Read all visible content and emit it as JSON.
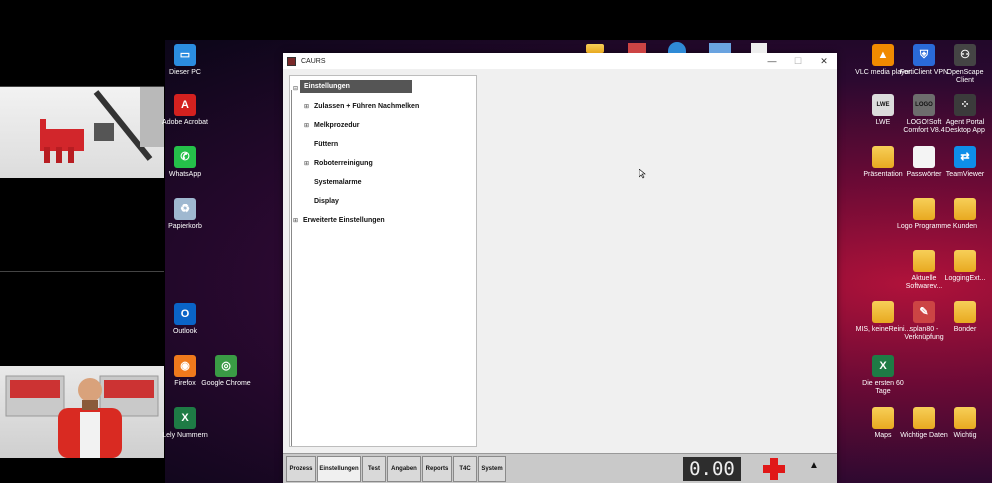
{
  "window": {
    "title": "CAURS",
    "minimize": "—",
    "maximize": "☐",
    "close": "✕"
  },
  "tree": {
    "items": [
      {
        "label": "Einstellungen",
        "expander": "⊟",
        "selected": true
      },
      {
        "label": "Zulassen + Führen Nachmelken",
        "expander": "⊞"
      },
      {
        "label": "Melkprozedur",
        "expander": "⊞"
      },
      {
        "label": "Füttern",
        "expander": ""
      },
      {
        "label": "Roboterreinigung",
        "expander": "⊞"
      },
      {
        "label": "Systemalarme",
        "expander": ""
      },
      {
        "label": "Display",
        "expander": ""
      },
      {
        "label": "Erweiterte Einstellungen",
        "expander": "⊞"
      }
    ]
  },
  "bottombar": {
    "tabs": [
      "Prozess",
      "Einstellungen",
      "Test",
      "Angaben",
      "Reports",
      "T4C",
      "System"
    ],
    "active_tab": "Einstellungen",
    "counter": "0.00",
    "arrow": "▲"
  },
  "desktop": {
    "left_icons": [
      {
        "label": "Dieser PC",
        "icon": "monitor-icon",
        "glyph": "▭",
        "color": "#2b8de0"
      },
      {
        "label": "Adobe Acrobat",
        "icon": "acrobat-icon",
        "glyph": "A",
        "color": "#d4211f"
      },
      {
        "label": "WhatsApp",
        "icon": "whatsapp-icon",
        "glyph": "✆",
        "color": "#25c04a"
      },
      {
        "label": "Papierkorb",
        "icon": "recycle-bin-icon",
        "glyph": "♻",
        "color": "#9fb8d0"
      },
      {
        "label": "Outlook",
        "icon": "outlook-icon",
        "glyph": "O",
        "color": "#0a64c7"
      },
      {
        "label": "Firefox",
        "icon": "firefox-icon",
        "glyph": "◉",
        "color": "#ef7a1c"
      },
      {
        "label": "Google Chrome",
        "icon": "chrome-icon",
        "glyph": "◎",
        "color": "#3a9b45"
      },
      {
        "label": "Lely Nummern",
        "icon": "excel-icon",
        "glyph": "X",
        "color": "#1e7b45"
      }
    ],
    "right_icons": [
      {
        "label": "VLC media player",
        "icon": "vlc-icon",
        "glyph": "▲",
        "color": "#f08a00"
      },
      {
        "label": "FortiClient VPN",
        "icon": "forticlient-icon",
        "glyph": "⛨",
        "color": "#2a6ad8"
      },
      {
        "label": "OpenScape Client",
        "icon": "openscape-icon",
        "glyph": "⚇",
        "color": "#444"
      },
      {
        "label": "LWE",
        "icon": "lwe-icon",
        "glyph": "LWE",
        "color": "#dcdcdc"
      },
      {
        "label": "LOGO!Soft Comfort V8.4",
        "icon": "logo-soft-icon",
        "glyph": "LOGO",
        "color": "#6d6d6d"
      },
      {
        "label": "Agent Portal Desktop App",
        "icon": "agent-portal-icon",
        "glyph": "⁘",
        "color": "#3b3b3b"
      },
      {
        "label": "Präsentation",
        "icon": "folder-icon",
        "glyph": "",
        "color": "folder"
      },
      {
        "label": "Passwörter",
        "icon": "document-icon",
        "glyph": "",
        "color": "doc"
      },
      {
        "label": "TeamViewer",
        "icon": "teamviewer-icon",
        "glyph": "⇄",
        "color": "#0e8ee9"
      },
      {
        "label": "Logo Programme",
        "icon": "folder-icon",
        "glyph": "",
        "color": "folder"
      },
      {
        "label": "Kunden",
        "icon": "folder-icon",
        "glyph": "",
        "color": "folder"
      },
      {
        "label": "Aktuelle Softwarev...",
        "icon": "folder-icon",
        "glyph": "",
        "color": "folder"
      },
      {
        "label": "LoggingExt...",
        "icon": "folder-icon",
        "glyph": "",
        "color": "folder"
      },
      {
        "label": "MIS, keineReini...",
        "icon": "folder-icon",
        "glyph": "",
        "color": "folder"
      },
      {
        "label": "splan80 - Verknüpfung",
        "icon": "pencil-icon",
        "glyph": "✎",
        "color": "#c44"
      },
      {
        "label": "Bonder",
        "icon": "folder-icon",
        "glyph": "",
        "color": "folder"
      },
      {
        "label": "Die ersten 60 Tage",
        "icon": "excel-icon",
        "glyph": "X",
        "color": "#1e7b45"
      },
      {
        "label": "Maps",
        "icon": "folder-icon",
        "glyph": "",
        "color": "folder"
      },
      {
        "label": "Wichtige Daten",
        "icon": "folder-icon",
        "glyph": "",
        "color": "folder"
      },
      {
        "label": "Wichtig",
        "icon": "folder-icon",
        "glyph": "",
        "color": "folder"
      }
    ]
  }
}
